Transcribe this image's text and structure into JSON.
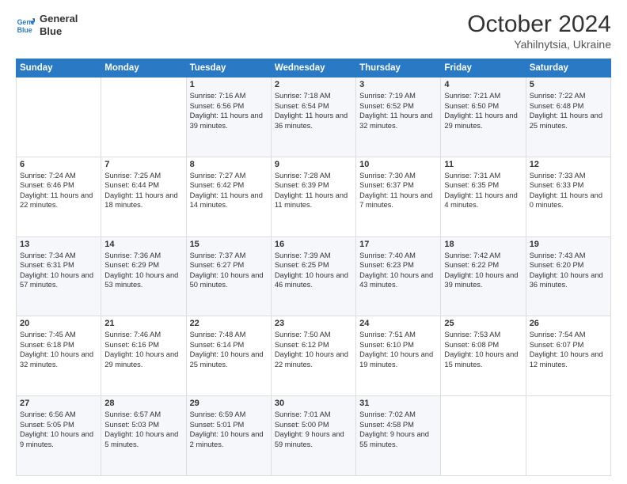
{
  "header": {
    "logo_line1": "General",
    "logo_line2": "Blue",
    "month": "October 2024",
    "location": "Yahilnytsia, Ukraine"
  },
  "days_of_week": [
    "Sunday",
    "Monday",
    "Tuesday",
    "Wednesday",
    "Thursday",
    "Friday",
    "Saturday"
  ],
  "weeks": [
    [
      {
        "day": "",
        "sunrise": "",
        "sunset": "",
        "daylight": ""
      },
      {
        "day": "",
        "sunrise": "",
        "sunset": "",
        "daylight": ""
      },
      {
        "day": "1",
        "sunrise": "Sunrise: 7:16 AM",
        "sunset": "Sunset: 6:56 PM",
        "daylight": "Daylight: 11 hours and 39 minutes."
      },
      {
        "day": "2",
        "sunrise": "Sunrise: 7:18 AM",
        "sunset": "Sunset: 6:54 PM",
        "daylight": "Daylight: 11 hours and 36 minutes."
      },
      {
        "day": "3",
        "sunrise": "Sunrise: 7:19 AM",
        "sunset": "Sunset: 6:52 PM",
        "daylight": "Daylight: 11 hours and 32 minutes."
      },
      {
        "day": "4",
        "sunrise": "Sunrise: 7:21 AM",
        "sunset": "Sunset: 6:50 PM",
        "daylight": "Daylight: 11 hours and 29 minutes."
      },
      {
        "day": "5",
        "sunrise": "Sunrise: 7:22 AM",
        "sunset": "Sunset: 6:48 PM",
        "daylight": "Daylight: 11 hours and 25 minutes."
      }
    ],
    [
      {
        "day": "6",
        "sunrise": "Sunrise: 7:24 AM",
        "sunset": "Sunset: 6:46 PM",
        "daylight": "Daylight: 11 hours and 22 minutes."
      },
      {
        "day": "7",
        "sunrise": "Sunrise: 7:25 AM",
        "sunset": "Sunset: 6:44 PM",
        "daylight": "Daylight: 11 hours and 18 minutes."
      },
      {
        "day": "8",
        "sunrise": "Sunrise: 7:27 AM",
        "sunset": "Sunset: 6:42 PM",
        "daylight": "Daylight: 11 hours and 14 minutes."
      },
      {
        "day": "9",
        "sunrise": "Sunrise: 7:28 AM",
        "sunset": "Sunset: 6:39 PM",
        "daylight": "Daylight: 11 hours and 11 minutes."
      },
      {
        "day": "10",
        "sunrise": "Sunrise: 7:30 AM",
        "sunset": "Sunset: 6:37 PM",
        "daylight": "Daylight: 11 hours and 7 minutes."
      },
      {
        "day": "11",
        "sunrise": "Sunrise: 7:31 AM",
        "sunset": "Sunset: 6:35 PM",
        "daylight": "Daylight: 11 hours and 4 minutes."
      },
      {
        "day": "12",
        "sunrise": "Sunrise: 7:33 AM",
        "sunset": "Sunset: 6:33 PM",
        "daylight": "Daylight: 11 hours and 0 minutes."
      }
    ],
    [
      {
        "day": "13",
        "sunrise": "Sunrise: 7:34 AM",
        "sunset": "Sunset: 6:31 PM",
        "daylight": "Daylight: 10 hours and 57 minutes."
      },
      {
        "day": "14",
        "sunrise": "Sunrise: 7:36 AM",
        "sunset": "Sunset: 6:29 PM",
        "daylight": "Daylight: 10 hours and 53 minutes."
      },
      {
        "day": "15",
        "sunrise": "Sunrise: 7:37 AM",
        "sunset": "Sunset: 6:27 PM",
        "daylight": "Daylight: 10 hours and 50 minutes."
      },
      {
        "day": "16",
        "sunrise": "Sunrise: 7:39 AM",
        "sunset": "Sunset: 6:25 PM",
        "daylight": "Daylight: 10 hours and 46 minutes."
      },
      {
        "day": "17",
        "sunrise": "Sunrise: 7:40 AM",
        "sunset": "Sunset: 6:23 PM",
        "daylight": "Daylight: 10 hours and 43 minutes."
      },
      {
        "day": "18",
        "sunrise": "Sunrise: 7:42 AM",
        "sunset": "Sunset: 6:22 PM",
        "daylight": "Daylight: 10 hours and 39 minutes."
      },
      {
        "day": "19",
        "sunrise": "Sunrise: 7:43 AM",
        "sunset": "Sunset: 6:20 PM",
        "daylight": "Daylight: 10 hours and 36 minutes."
      }
    ],
    [
      {
        "day": "20",
        "sunrise": "Sunrise: 7:45 AM",
        "sunset": "Sunset: 6:18 PM",
        "daylight": "Daylight: 10 hours and 32 minutes."
      },
      {
        "day": "21",
        "sunrise": "Sunrise: 7:46 AM",
        "sunset": "Sunset: 6:16 PM",
        "daylight": "Daylight: 10 hours and 29 minutes."
      },
      {
        "day": "22",
        "sunrise": "Sunrise: 7:48 AM",
        "sunset": "Sunset: 6:14 PM",
        "daylight": "Daylight: 10 hours and 25 minutes."
      },
      {
        "day": "23",
        "sunrise": "Sunrise: 7:50 AM",
        "sunset": "Sunset: 6:12 PM",
        "daylight": "Daylight: 10 hours and 22 minutes."
      },
      {
        "day": "24",
        "sunrise": "Sunrise: 7:51 AM",
        "sunset": "Sunset: 6:10 PM",
        "daylight": "Daylight: 10 hours and 19 minutes."
      },
      {
        "day": "25",
        "sunrise": "Sunrise: 7:53 AM",
        "sunset": "Sunset: 6:08 PM",
        "daylight": "Daylight: 10 hours and 15 minutes."
      },
      {
        "day": "26",
        "sunrise": "Sunrise: 7:54 AM",
        "sunset": "Sunset: 6:07 PM",
        "daylight": "Daylight: 10 hours and 12 minutes."
      }
    ],
    [
      {
        "day": "27",
        "sunrise": "Sunrise: 6:56 AM",
        "sunset": "Sunset: 5:05 PM",
        "daylight": "Daylight: 10 hours and 9 minutes."
      },
      {
        "day": "28",
        "sunrise": "Sunrise: 6:57 AM",
        "sunset": "Sunset: 5:03 PM",
        "daylight": "Daylight: 10 hours and 5 minutes."
      },
      {
        "day": "29",
        "sunrise": "Sunrise: 6:59 AM",
        "sunset": "Sunset: 5:01 PM",
        "daylight": "Daylight: 10 hours and 2 minutes."
      },
      {
        "day": "30",
        "sunrise": "Sunrise: 7:01 AM",
        "sunset": "Sunset: 5:00 PM",
        "daylight": "Daylight: 9 hours and 59 minutes."
      },
      {
        "day": "31",
        "sunrise": "Sunrise: 7:02 AM",
        "sunset": "Sunset: 4:58 PM",
        "daylight": "Daylight: 9 hours and 55 minutes."
      },
      {
        "day": "",
        "sunrise": "",
        "sunset": "",
        "daylight": ""
      },
      {
        "day": "",
        "sunrise": "",
        "sunset": "",
        "daylight": ""
      }
    ]
  ]
}
